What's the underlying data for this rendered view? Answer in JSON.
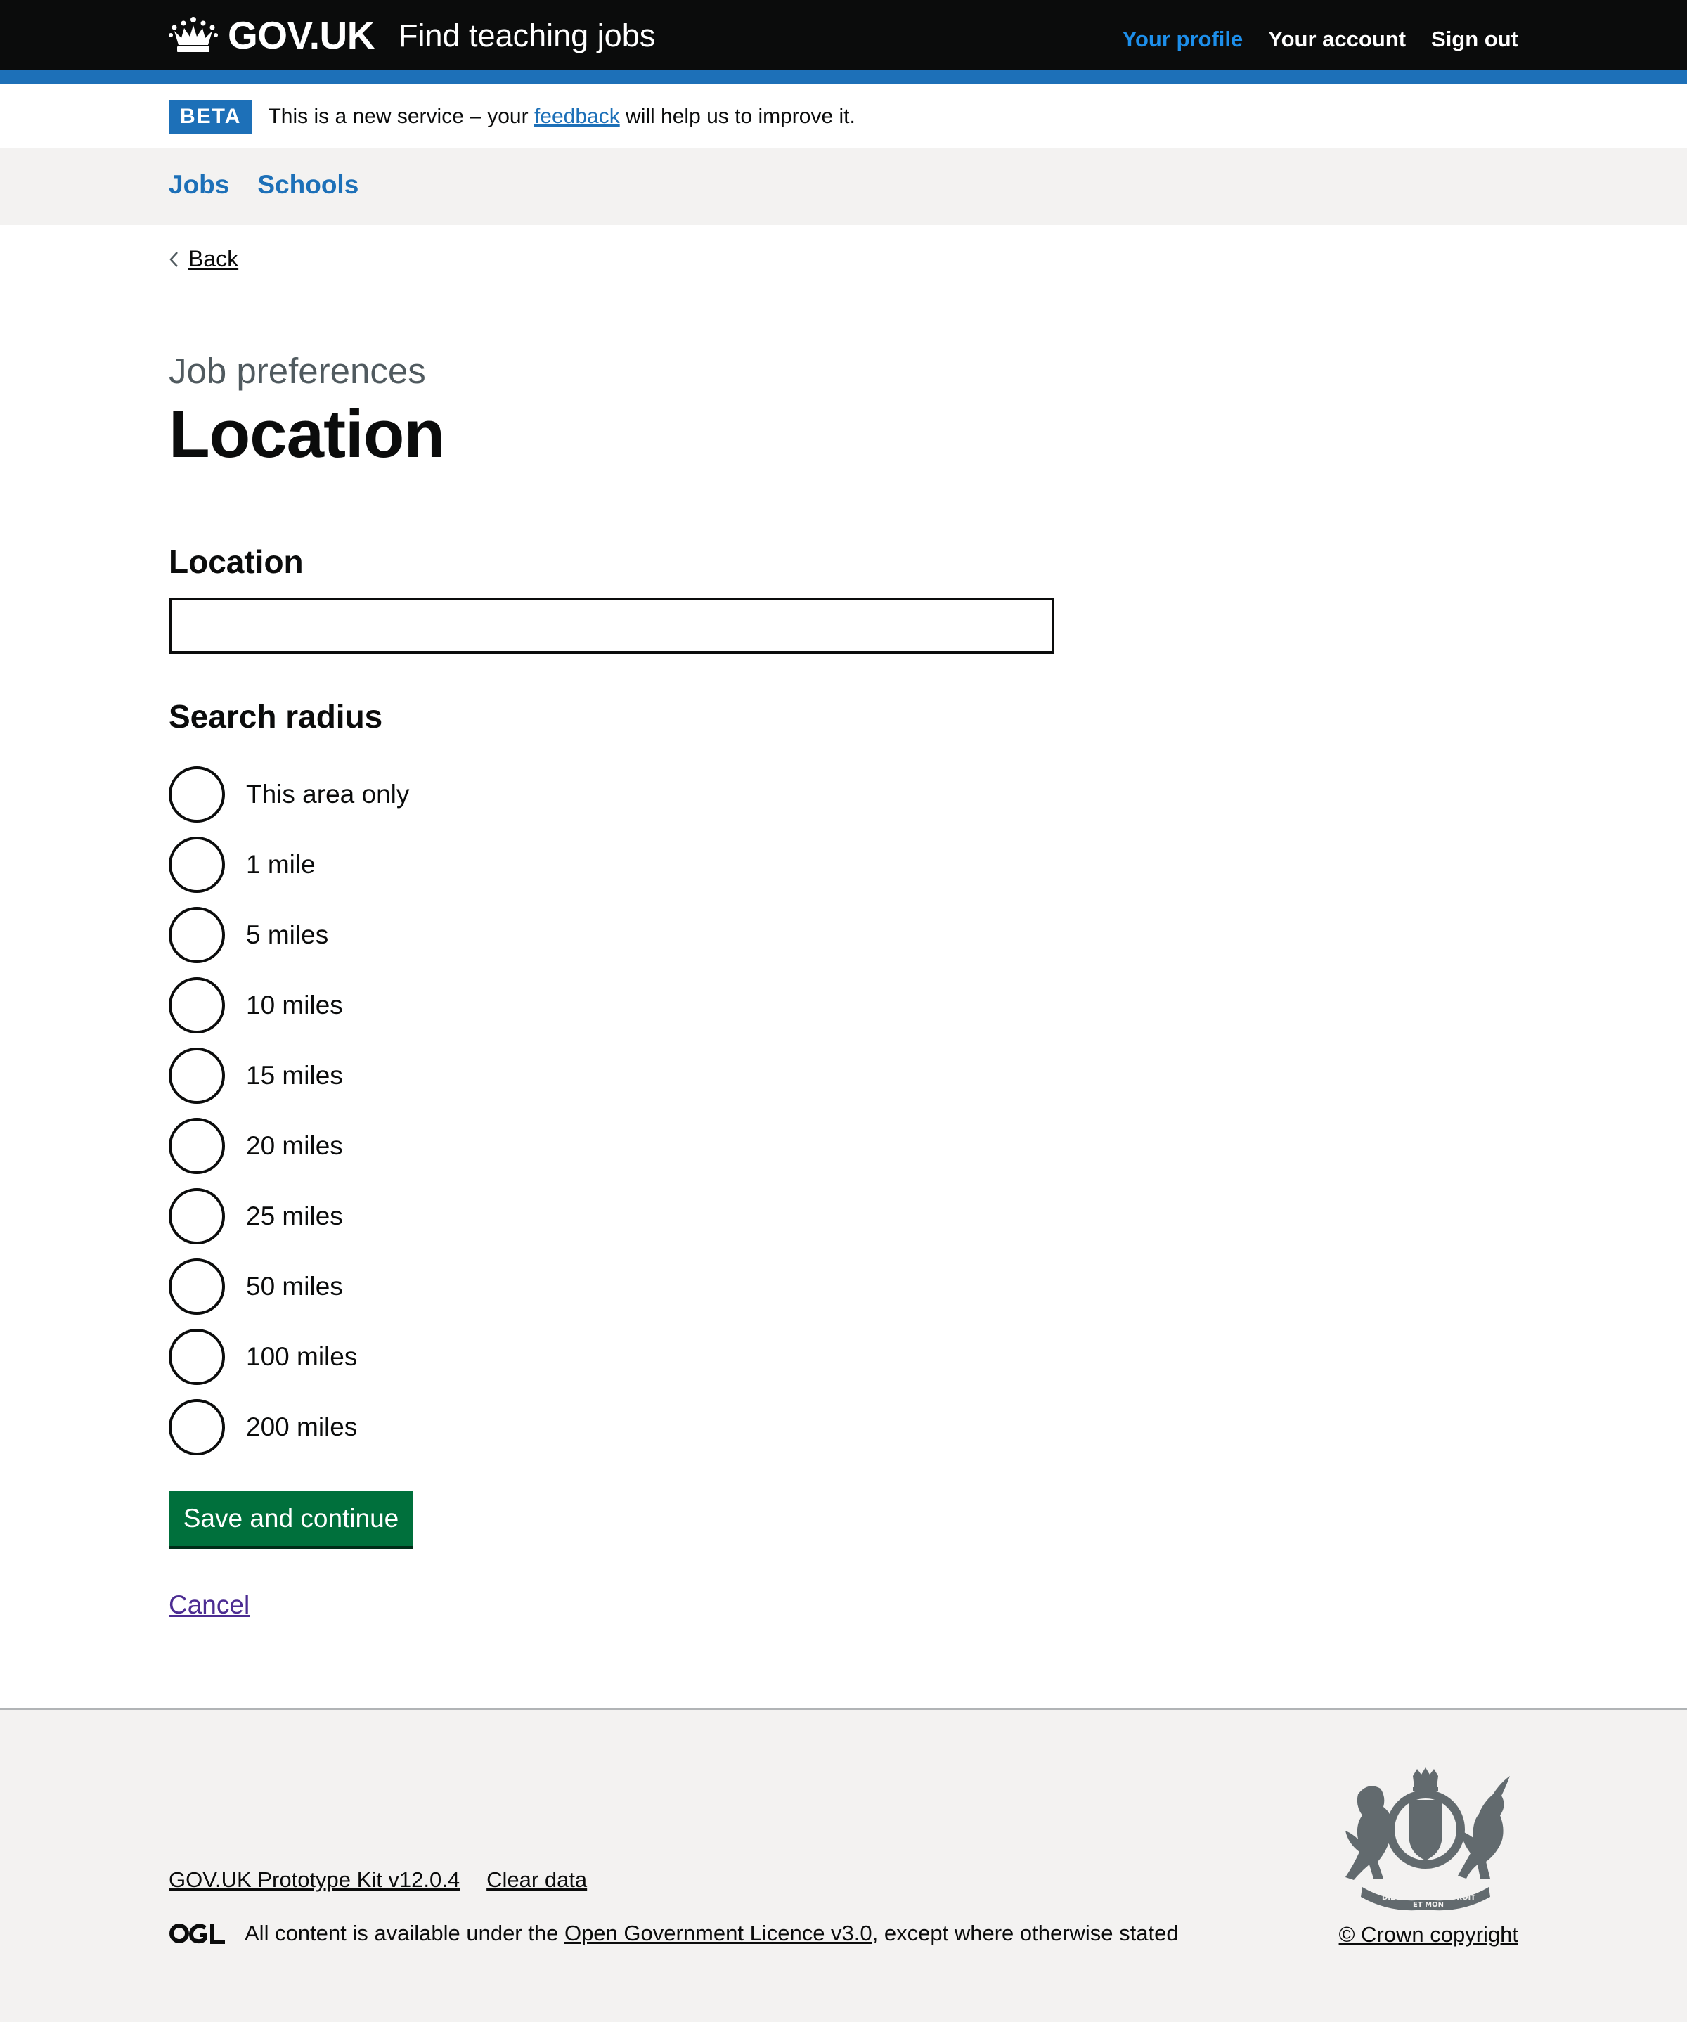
{
  "header": {
    "logo_text": "GOV.UK",
    "service_name": "Find teaching jobs",
    "nav": [
      {
        "label": "Your profile",
        "active": true
      },
      {
        "label": "Your account",
        "active": false
      },
      {
        "label": "Sign out",
        "active": false
      }
    ],
    "brand_color": "#1d70b8"
  },
  "phase_banner": {
    "tag": "BETA",
    "text_before": "This is a new service – your ",
    "link": "feedback",
    "text_after": " will help us to improve it."
  },
  "subnav": {
    "items": [
      {
        "label": "Jobs"
      },
      {
        "label": "Schools"
      }
    ]
  },
  "main": {
    "back_label": "Back",
    "caption": "Job preferences",
    "title": "Location",
    "location_field": {
      "label": "Location",
      "value": ""
    },
    "radius": {
      "legend": "Search radius",
      "options": [
        {
          "label": "This area only"
        },
        {
          "label": "1 mile"
        },
        {
          "label": "5 miles"
        },
        {
          "label": "10 miles"
        },
        {
          "label": "15 miles"
        },
        {
          "label": "20 miles"
        },
        {
          "label": "25 miles"
        },
        {
          "label": "50 miles"
        },
        {
          "label": "100 miles"
        },
        {
          "label": "200 miles"
        }
      ]
    },
    "submit_label": "Save and continue",
    "cancel_label": "Cancel",
    "button_color": "#00703c"
  },
  "footer": {
    "links": [
      {
        "label": "GOV.UK Prototype Kit v12.0.4"
      },
      {
        "label": "Clear data"
      }
    ],
    "ogl_label": "OGL",
    "licence_before": "All content is available under the ",
    "licence_link": "Open Government Licence v3.0",
    "licence_after": ", except where otherwise stated",
    "copyright": "© Crown copyright",
    "crest_lettering": [
      "DIEU",
      "ET MON",
      "DROIT",
      "HONI SOIT QUI MAL Y PENSE"
    ]
  }
}
